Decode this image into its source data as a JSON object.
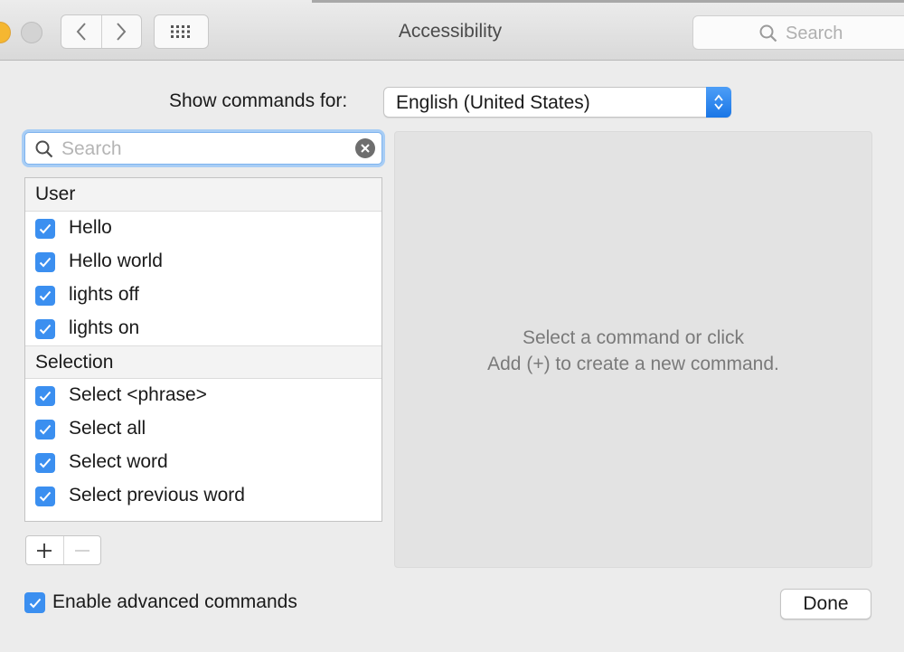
{
  "window": {
    "title": "Accessibility"
  },
  "toolbar": {
    "search_placeholder": "Search"
  },
  "show_commands": {
    "label": "Show commands for:",
    "selected_value": "English (United States)"
  },
  "filter": {
    "placeholder": "Search"
  },
  "command_list": {
    "groups": [
      {
        "title": "User",
        "items": [
          {
            "label": "Hello",
            "checked": true
          },
          {
            "label": "Hello world",
            "checked": true
          },
          {
            "label": "lights off",
            "checked": true
          },
          {
            "label": "lights on",
            "checked": true
          }
        ]
      },
      {
        "title": "Selection",
        "items": [
          {
            "label": "Select <phrase>",
            "checked": true
          },
          {
            "label": "Select all",
            "checked": true
          },
          {
            "label": "Select word",
            "checked": true
          },
          {
            "label": "Select previous word",
            "checked": true
          }
        ]
      }
    ]
  },
  "detail": {
    "line1": "Select a command or click",
    "line2": "Add (+) to create a new command."
  },
  "footer": {
    "advanced_label": "Enable advanced commands",
    "advanced_checked": true,
    "done_label": "Done"
  },
  "colors": {
    "accent": "#3b8ff0",
    "traffic_yellow": "#f5b731"
  },
  "icons": [
    "back-icon",
    "forward-icon",
    "show-all-grid-icon",
    "search-icon",
    "clear-icon",
    "checkmark-icon",
    "add-icon",
    "remove-icon",
    "popup-arrows-icon"
  ]
}
